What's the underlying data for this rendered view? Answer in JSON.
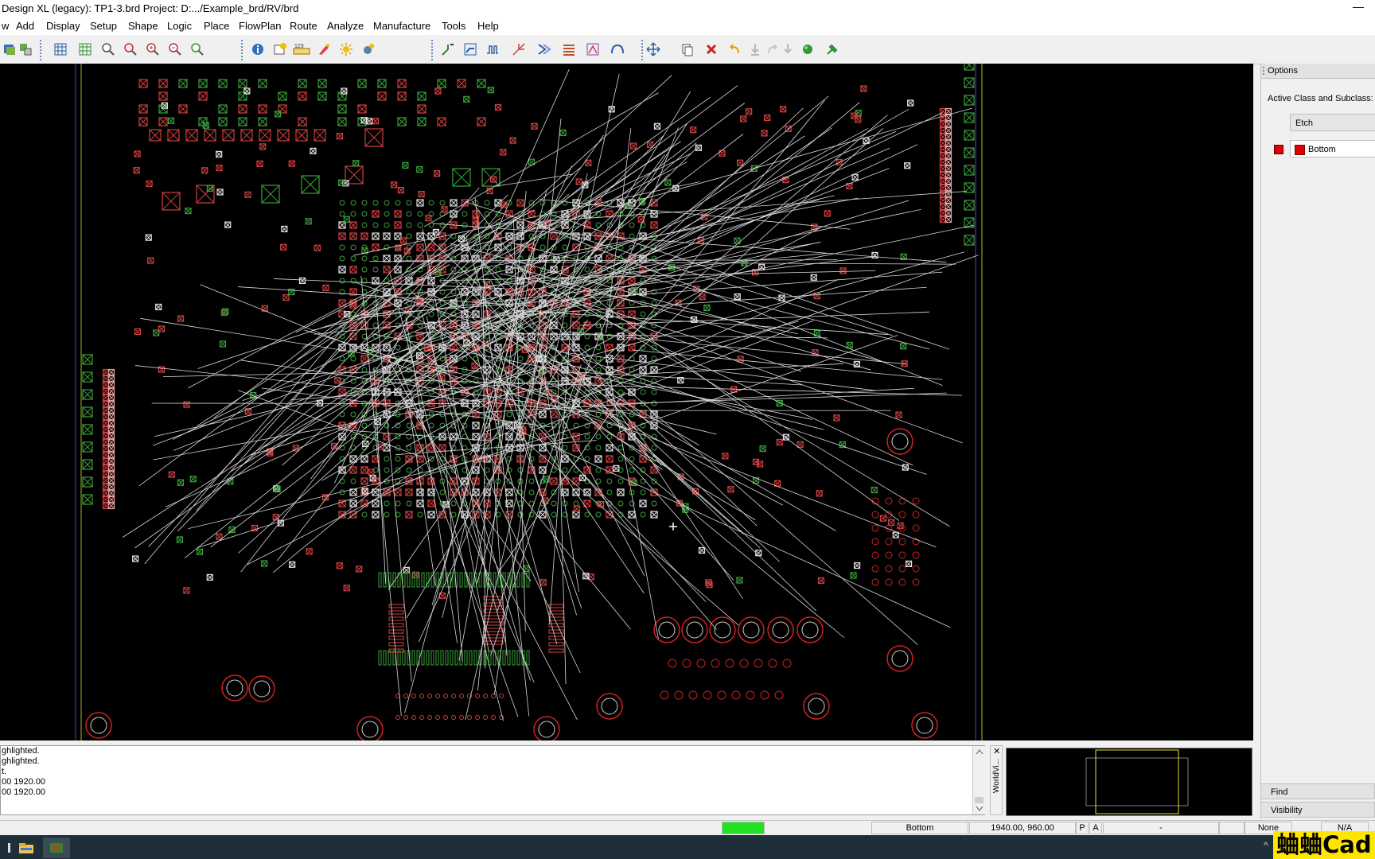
{
  "window": {
    "title": "Design XL (legacy): TP1-3.brd  Project: D:.../Example_brd/RV/brd",
    "minimize_glyph": "—"
  },
  "menu": [
    "w",
    "Add",
    "Display",
    "Setup",
    "Shape",
    "Logic",
    "Place",
    "FlowPlan",
    "Route",
    "Analyze",
    "Manufacture",
    "Tools",
    "Help"
  ],
  "toolbar": {
    "icons": [
      "layers-icon",
      "layers-edit-icon",
      "grid-icon",
      "grid-toggle-icon",
      "zoom-fit-icon",
      "zoom-points-icon",
      "zoom-in-icon",
      "zoom-out-icon",
      "zoom-previous-icon",
      "info-icon",
      "show-element-icon",
      "measure-icon",
      "clean-icon",
      "highlight-icon",
      "dehighlight-icon",
      "add-connect-icon",
      "slide-icon",
      "delay-tune-icon",
      "fanout-icon",
      "route-icon",
      "spread-icon",
      "gloss-icon",
      "custom-smooth-icon",
      "move-icon",
      "copy-icon",
      "delete-icon",
      "undo-icon",
      "redo-icon",
      "unrats-icon",
      "pin-swap-icon",
      "ratsnest-icon",
      "place-icon"
    ]
  },
  "console": {
    "lines": [
      "ghlighted.",
      "ghlighted.",
      "t.",
      "00 1920.00",
      "00 1920.00"
    ]
  },
  "worldview": {
    "tab_label": "WorldVi..."
  },
  "options_panel": {
    "header": "Options",
    "active_class_label": "Active Class and Subclass:",
    "class_value": "Etch",
    "subclass_value": "Bottom",
    "subclass_color": "#e00000"
  },
  "panel_tabs": {
    "find": "Find",
    "visibility": "Visibility"
  },
  "status": {
    "idle_color": "#22e022",
    "layer": "Bottom",
    "coords": "1940.00, 960.00",
    "p_flag": "P",
    "a_flag": "A",
    "mode": "-",
    "dfa": "None",
    "extra": "N/A"
  },
  "watermark": "蛐蛐Cad"
}
